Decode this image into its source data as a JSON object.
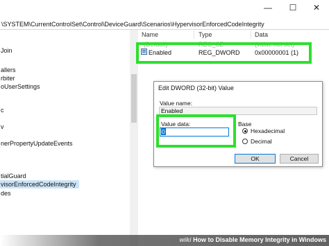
{
  "window": {
    "minimize_icon": "minimize-icon",
    "maximize_icon": "maximize-icon",
    "close_icon": "close-icon"
  },
  "address_bar": {
    "path": "\\SYSTEM\\CurrentControlSet\\Control\\DeviceGuard\\Scenarios\\HypervisorEnforcedCodeIntegrity"
  },
  "tree": {
    "items": [
      {
        "label": "Join"
      },
      {
        "label": "allers"
      },
      {
        "label": "rbiter"
      },
      {
        "label": "oUserSettings"
      },
      {
        "label": "c"
      },
      {
        "label": "v"
      },
      {
        "label": "nerPropertyUpdateEvents"
      },
      {
        "label": ""
      },
      {
        "label": "tialGuard"
      },
      {
        "label": "visorEnforcedCodeIntegrity"
      },
      {
        "label": "des"
      }
    ]
  },
  "values_list": {
    "columns": {
      "name": "Name",
      "type": "Type",
      "data": "Data"
    },
    "rows": [
      {
        "name": "(Default)",
        "type": "REG_SZ",
        "data": "(value not set)"
      },
      {
        "name": "Enabled",
        "type": "REG_DWORD",
        "data": "0x00000001 (1)"
      }
    ],
    "value_icon": "registry-value-icon"
  },
  "dialog": {
    "title": "Edit DWORD (32-bit) Value",
    "value_name_label": "Value name:",
    "value_name": "Enabled",
    "value_data_label": "Value data:",
    "value_data": "0",
    "base_label": "Base",
    "hex_label": "Hexadecimal",
    "dec_label": "Decimal",
    "base_selected": "Hexadecimal",
    "ok_label": "OK",
    "cancel_label": "Cancel"
  },
  "highlight_color": "#2ddf2d",
  "footer": {
    "brand": "wiki",
    "text": "How to Disable Memory Integrity in Windows"
  }
}
